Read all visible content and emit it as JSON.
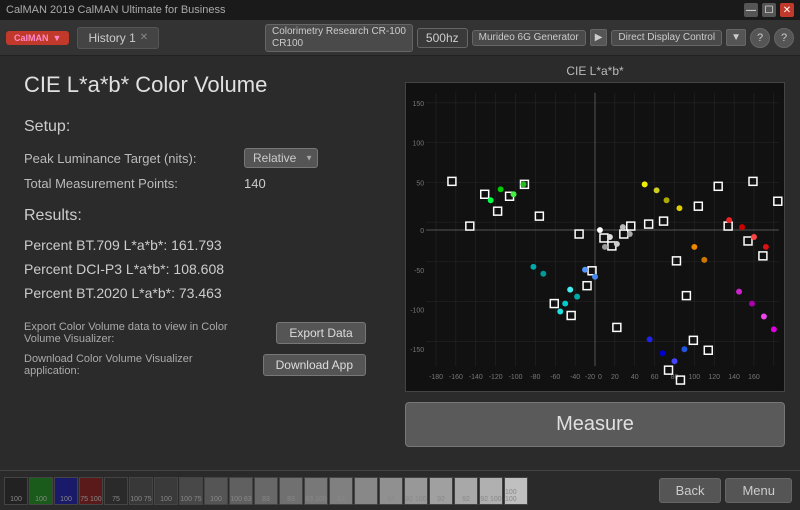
{
  "titleBar": {
    "title": "CalMAN 2019 CalMAN Ultimate for Business"
  },
  "logo": {
    "text": "CalMAN",
    "arrow": "▼"
  },
  "tabs": [
    {
      "label": "History 1",
      "closeable": true
    }
  ],
  "deviceBar": {
    "device1": "Colorimetry Research CR-100",
    "device1sub": "CR100",
    "freq": "500hz",
    "device2": "Murideo 6G Generator",
    "device3": "Direct Display Control",
    "arrowLabel": "▼"
  },
  "page": {
    "title": "CIE L*a*b* Color Volume",
    "setup": "Setup:",
    "peakLuminanceLabel": "Peak Luminance Target (nits):",
    "peakLuminanceValue": "Relative",
    "totalPointsLabel": "Total Measurement Points:",
    "totalPointsValue": "140",
    "results": "Results:",
    "result1": "Percent BT.709 L*a*b*: 161.793",
    "result2": "Percent DCI-P3 L*a*b*: 108.608",
    "result3": "Percent BT.2020 L*a*b*: 73.463",
    "exportLabel": "Export Color Volume data to view in Color Volume Visualizer:",
    "exportBtn": "Export Data",
    "downloadLabel": "Download Color Volume Visualizer application:",
    "downloadBtn": "Download App"
  },
  "chart": {
    "title": "CIE L*a*b*",
    "xAxisLabels": [
      "-180",
      "-160",
      "-140",
      "-120",
      "-100",
      "-80",
      "-60",
      "-40",
      "-20",
      "0",
      "20",
      "40",
      "60",
      "80",
      "100",
      "120",
      "140",
      "160"
    ],
    "yAxisLabels": [
      "150",
      "100",
      "50",
      "0",
      "-50",
      "-100",
      "-150"
    ]
  },
  "measure": {
    "label": "Measure"
  },
  "bottomNav": {
    "back": "Back",
    "menu": "Menu"
  },
  "swatches": [
    {
      "color": "#444",
      "label": "100"
    },
    {
      "color": "#1a6b1a",
      "label": "100"
    },
    {
      "color": "#1a1a8a",
      "label": "100"
    },
    {
      "color": "#6a1a1a",
      "label": "75 100"
    },
    {
      "color": "#333",
      "label": "75"
    },
    {
      "color": "#555",
      "label": "100 75"
    },
    {
      "color": "#555",
      "label": "100"
    },
    {
      "color": "#666",
      "label": "100 75"
    },
    {
      "color": "#777",
      "label": "100"
    },
    {
      "color": "#888",
      "label": "100 83"
    },
    {
      "color": "#999",
      "label": "83"
    },
    {
      "color": "#aaa",
      "label": "83"
    },
    {
      "color": "#bbb",
      "label": "83 100"
    },
    {
      "color": "#ccc",
      "label": "83"
    },
    {
      "color": "#ddd",
      "label": "100"
    },
    {
      "color": "#eee",
      "label": "92"
    },
    {
      "color": "#fff",
      "label": "92 100"
    },
    {
      "color": "#eee",
      "label": "92"
    },
    {
      "color": "#ddd",
      "label": "92"
    },
    {
      "color": "#ccc",
      "label": "92 100"
    },
    {
      "color": "#bbb",
      "label": "100 100"
    }
  ]
}
